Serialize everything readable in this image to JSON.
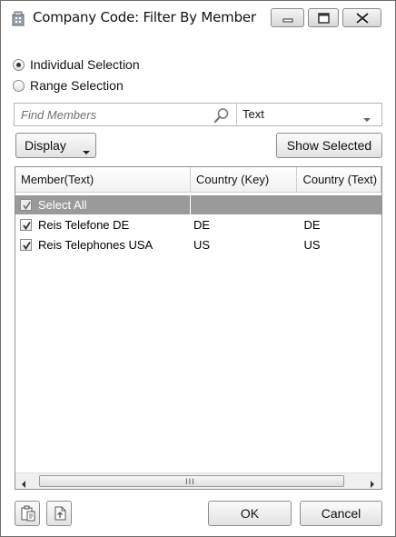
{
  "window": {
    "title": "Company Code: Filter By Member",
    "controls": [
      "minimize-icon",
      "maximize-icon",
      "close-icon"
    ]
  },
  "selection_mode": {
    "options": [
      {
        "label": "Individual Selection",
        "checked": true
      },
      {
        "label": "Range Selection",
        "checked": false
      }
    ]
  },
  "search": {
    "placeholder": "Find Members",
    "value": "",
    "field_select": "Text"
  },
  "toolbar": {
    "display_label": "Display",
    "show_selected_label": "Show Selected"
  },
  "table": {
    "columns": [
      "Member(Text)",
      "Country (Key)",
      "Country (Text)"
    ],
    "select_all": {
      "label": "Select All",
      "checked": true
    },
    "rows": [
      {
        "member": "Reis Telefone DE",
        "country_key": "DE",
        "country_text": "DE",
        "checked": true
      },
      {
        "member": "Reis Telephones USA",
        "country_key": "US",
        "country_text": "US",
        "checked": true
      }
    ]
  },
  "footer": {
    "ok_label": "OK",
    "cancel_label": "Cancel",
    "icons": [
      "paste-icon",
      "export-icon"
    ]
  },
  "colors": {
    "selected_row": "#9a9a9a",
    "border": "#8d8d8d"
  }
}
